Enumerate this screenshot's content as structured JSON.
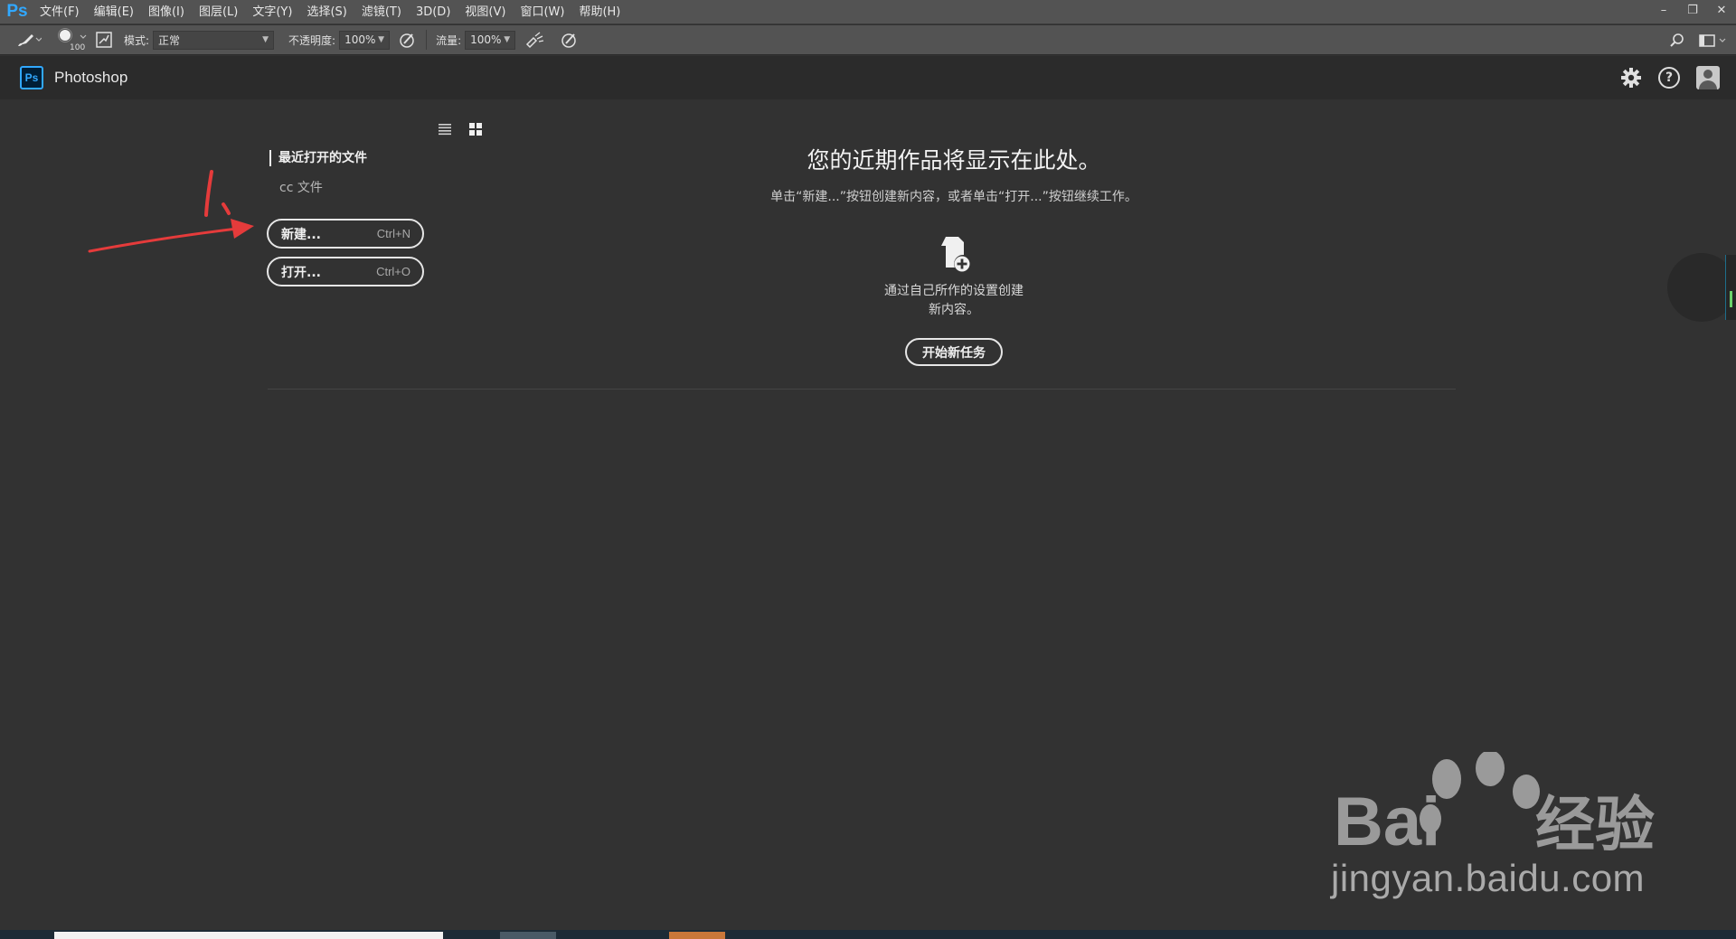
{
  "app": {
    "logo": "Ps"
  },
  "menu": {
    "items": [
      "文件(F)",
      "编辑(E)",
      "图像(I)",
      "图层(L)",
      "文字(Y)",
      "选择(S)",
      "滤镜(T)",
      "3D(D)",
      "视图(V)",
      "窗口(W)",
      "帮助(H)"
    ]
  },
  "window": {
    "minimize": "–",
    "restore": "❐",
    "close": "✕"
  },
  "options": {
    "brush_size": "100",
    "mode_label": "模式:",
    "mode_value": "正常",
    "opacity_label": "不透明度:",
    "opacity_value": "100%",
    "flow_label": "流量:",
    "flow_value": "100%"
  },
  "header": {
    "logo": "Ps",
    "title": "Photoshop"
  },
  "left_panel": {
    "recent_label": "最近打开的文件",
    "cc_label": "cc 文件",
    "new_button": {
      "label": "新建...",
      "shortcut": "Ctrl+N"
    },
    "open_button": {
      "label": "打开...",
      "shortcut": "Ctrl+O"
    }
  },
  "main": {
    "title": "您的近期作品将显示在此处。",
    "subtitle": "单击“新建...”按钮创建新内容，或者单击“打开...”按钮继续工作。",
    "create_line1": "通过自己所作的设置创建",
    "create_line2": "新内容。",
    "start_button": "开始新任务"
  },
  "watermark": {
    "big": "Bai",
    "cn": "经验",
    "url": "jingyan.baidu.com"
  },
  "colors": {
    "accent": "#31a8ff",
    "background": "#323232",
    "annotation": "#e53b3b"
  },
  "icons": [
    "brush-icon",
    "brush-preset-icon",
    "toggle-brush-panel-icon",
    "pressure-opacity-icon",
    "airbrush-icon",
    "pressure-size-icon",
    "search-icon",
    "workspace-icon",
    "gear-icon",
    "help-icon",
    "user-icon",
    "list-view-icon",
    "grid-view-icon",
    "new-document-icon"
  ]
}
